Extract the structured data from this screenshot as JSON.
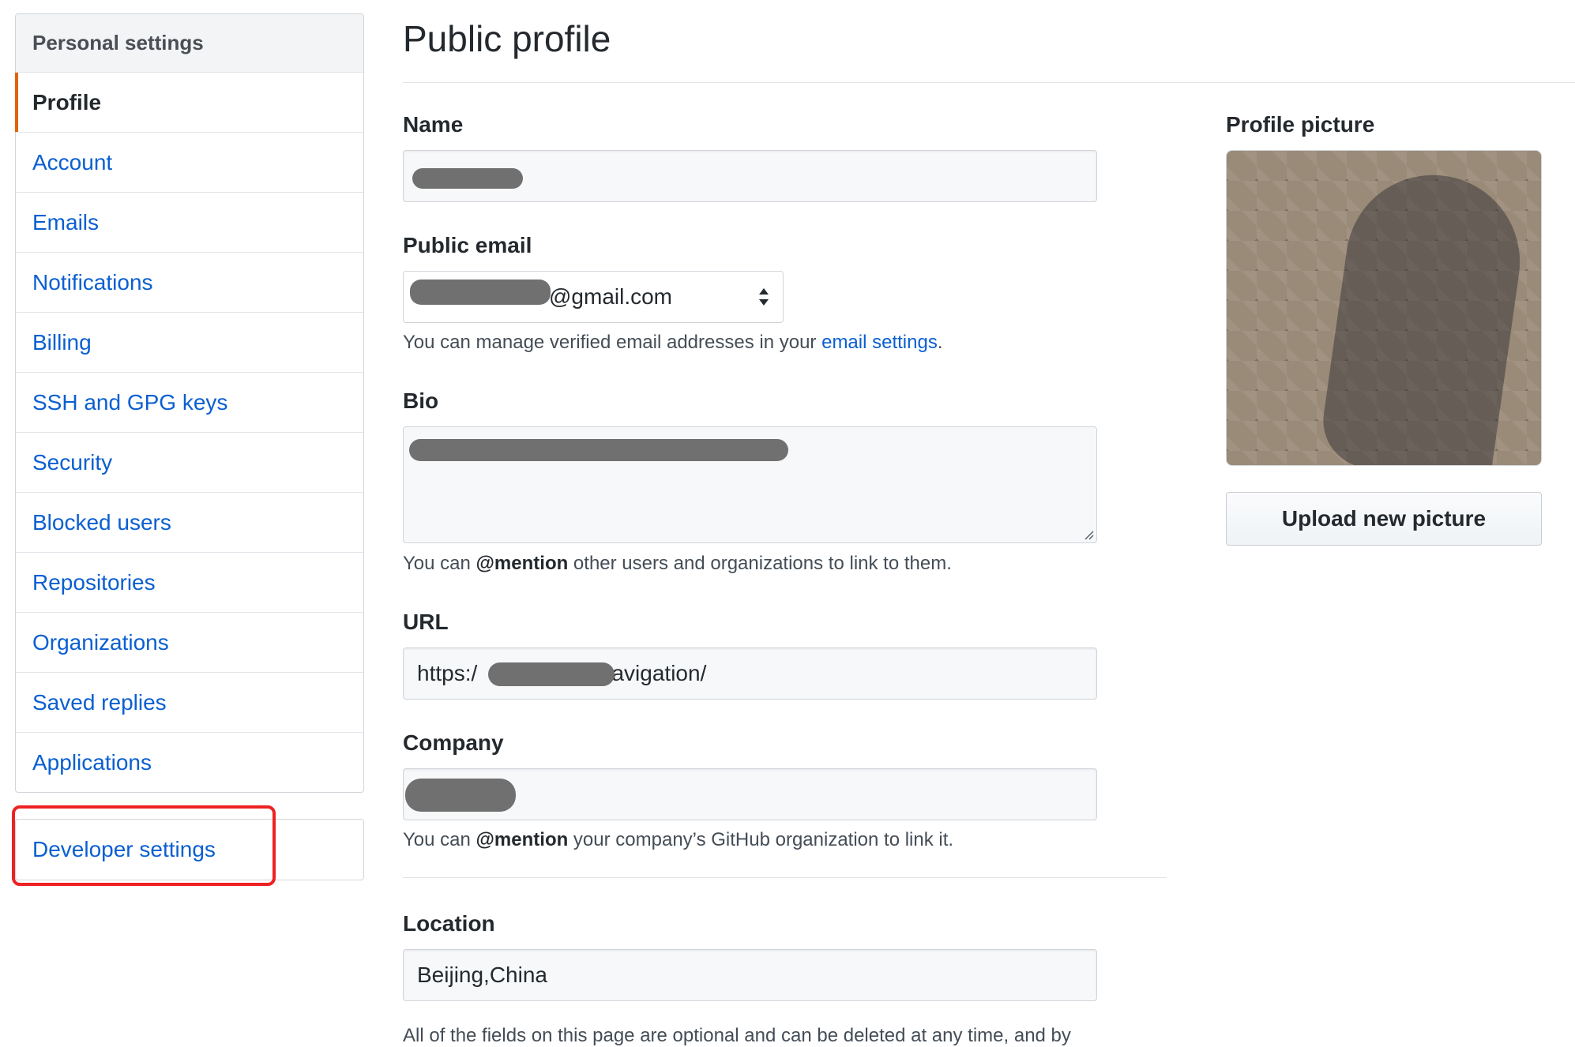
{
  "sidebar": {
    "header": "Personal settings",
    "items": [
      {
        "label": "Profile"
      },
      {
        "label": "Account"
      },
      {
        "label": "Emails"
      },
      {
        "label": "Notifications"
      },
      {
        "label": "Billing"
      },
      {
        "label": "SSH and GPG keys"
      },
      {
        "label": "Security"
      },
      {
        "label": "Blocked users"
      },
      {
        "label": "Repositories"
      },
      {
        "label": "Organizations"
      },
      {
        "label": "Saved replies"
      },
      {
        "label": "Applications"
      }
    ],
    "developer": "Developer settings"
  },
  "main": {
    "title": "Public profile",
    "name": {
      "label": "Name",
      "value": ""
    },
    "email": {
      "label": "Public email",
      "value": "@gmail.com",
      "note_prefix": "You can manage verified email addresses in your ",
      "note_link": "email settings",
      "note_suffix": "."
    },
    "bio": {
      "label": "Bio",
      "note_prefix": "You can ",
      "note_bold": "@mention",
      "note_suffix": " other users and organizations to link to them."
    },
    "url": {
      "label": "URL",
      "value_prefix": "https:/",
      "value_suffix": "Navigation/"
    },
    "company": {
      "label": "Company",
      "note_prefix": "You can ",
      "note_bold": "@mention",
      "note_suffix": " your company’s GitHub organization to link it."
    },
    "location": {
      "label": "Location",
      "value": "Beijing,China"
    },
    "footer_note": "All of the fields on this page are optional and can be deleted at any time, and by"
  },
  "picture": {
    "label": "Profile picture",
    "upload_label": "Upload new picture"
  }
}
